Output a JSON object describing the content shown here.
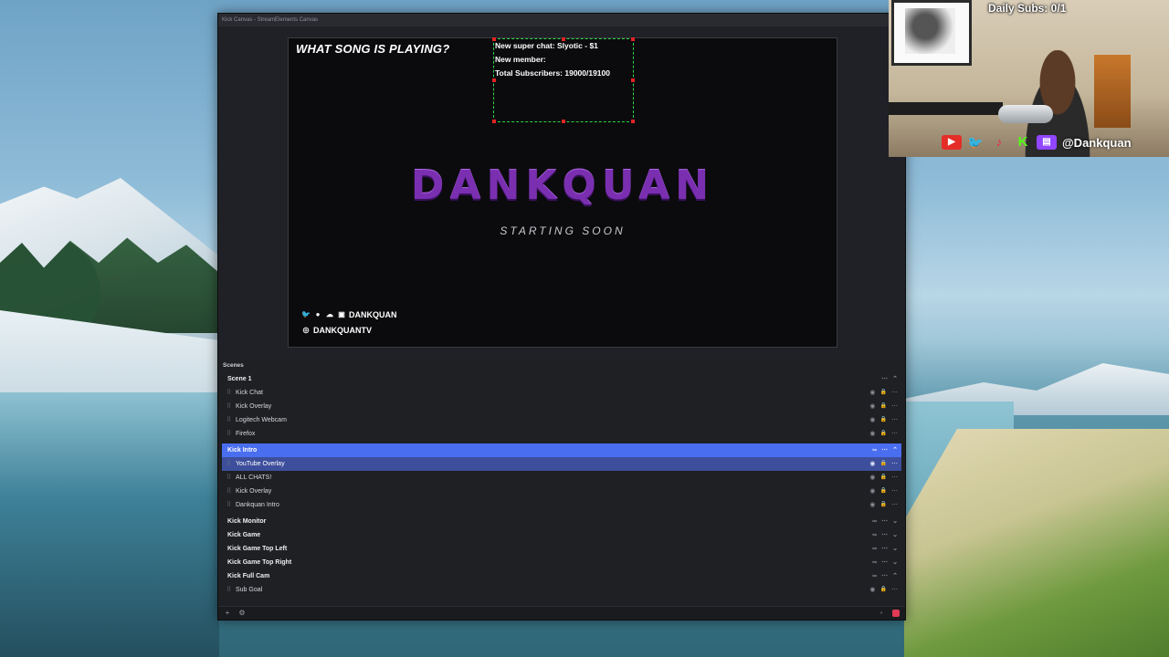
{
  "window": {
    "title": "Kick Canvas - StreamElements Canvas"
  },
  "canvas": {
    "song_title": "WHAT SONG IS PLAYING?",
    "alerts": [
      "New super chat: Slyotic - $1",
      "New member:",
      "Total Subscribers: 19000/19100"
    ],
    "brand": "DANKQUAN",
    "subtitle": "STARTING SOON",
    "social_line1": "DANKQUAN",
    "social_line2": "DANKQUANTV",
    "colors": {
      "brand_purple": "#7a2fb0",
      "alert_box": "#2ed64a"
    }
  },
  "scenes": {
    "header": "Scenes",
    "groups": [
      {
        "name": "Scene 1",
        "expanded": true,
        "items": [
          "Kick Chat",
          "Kick Overlay",
          "Logitech Webcam",
          "Firefox"
        ]
      },
      {
        "name": "Kick Intro",
        "expanded": true,
        "active": true,
        "items": [
          "YouTube Overlay",
          "ALL CHATS!",
          "Kick Overlay",
          "Dankquan Intro"
        ]
      },
      {
        "name": "Kick Monitor",
        "expanded": false,
        "items": []
      },
      {
        "name": "Kick Game",
        "expanded": false,
        "items": []
      },
      {
        "name": "Kick Game Top Left",
        "expanded": false,
        "items": []
      },
      {
        "name": "Kick Game Top Right",
        "expanded": false,
        "items": []
      },
      {
        "name": "Kick Full Cam",
        "expanded": true,
        "items": [
          "Sub Goal"
        ]
      }
    ],
    "colors": {
      "active": "#4a6ef0",
      "selected": "#3d4f9c"
    }
  },
  "webcam": {
    "daily_subs": "Daily Subs: 0/1",
    "handle": "@Dankquan",
    "icons": [
      "youtube-icon",
      "twitter-icon",
      "tiktok-icon",
      "kick-icon",
      "twitch-icon"
    ]
  }
}
